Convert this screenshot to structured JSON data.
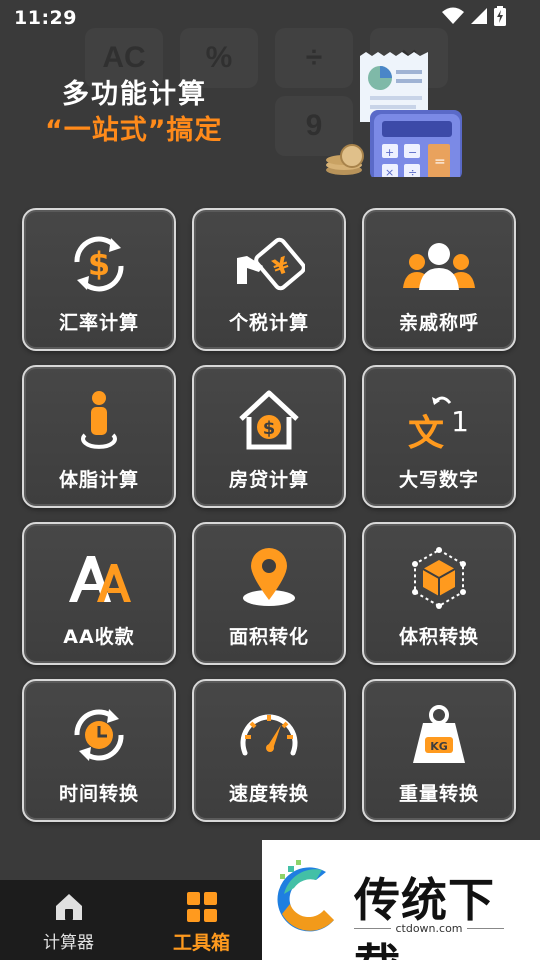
{
  "status_bar": {
    "time": "11:29"
  },
  "banner": {
    "title": "多功能计算",
    "subtitle": "“一站式”搞定",
    "ghost_keys": [
      "AC",
      "%",
      "÷",
      "×",
      "9"
    ]
  },
  "tools": [
    {
      "label": "汇率计算",
      "icon": "exchange-rate-icon"
    },
    {
      "label": "个税计算",
      "icon": "tax-icon"
    },
    {
      "label": "亲戚称呼",
      "icon": "relatives-icon"
    },
    {
      "label": "体脂计算",
      "icon": "body-fat-icon"
    },
    {
      "label": "房贷计算",
      "icon": "mortgage-icon"
    },
    {
      "label": "大写数字",
      "icon": "uppercase-number-icon"
    },
    {
      "label": "AA收款",
      "icon": "aa-split-icon"
    },
    {
      "label": "面积转化",
      "icon": "area-icon"
    },
    {
      "label": "体积转换",
      "icon": "volume-icon"
    },
    {
      "label": "时间转换",
      "icon": "time-icon"
    },
    {
      "label": "速度转换",
      "icon": "speed-icon"
    },
    {
      "label": "重量转换",
      "icon": "weight-icon"
    }
  ],
  "bottom_nav": {
    "home_label": "计算器",
    "tools_label": "工具箱",
    "active": "tools"
  },
  "watermark": {
    "brand": "传统下载",
    "url": "ctdown.com"
  },
  "colors": {
    "accent": "#ff9a1e",
    "background": "#3a3a3a",
    "tile_border": "#d8d8d8"
  }
}
